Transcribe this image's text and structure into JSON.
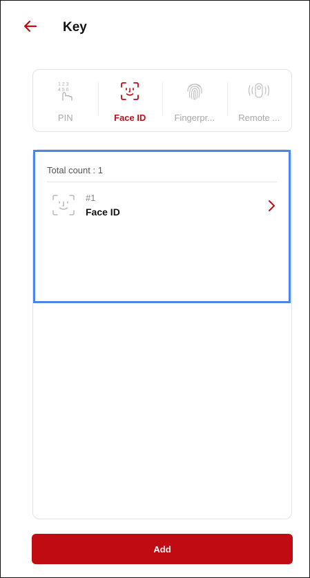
{
  "header": {
    "title": "Key",
    "back_icon": "arrow-left-icon",
    "accent_color": "#c10b12"
  },
  "tabs": [
    {
      "label": "PIN",
      "icon": "pin-keypad-icon",
      "active": false
    },
    {
      "label": "Face ID",
      "icon": "face-id-icon",
      "active": true
    },
    {
      "label": "Fingerpr...",
      "icon": "fingerprint-icon",
      "active": false
    },
    {
      "label": "Remote ...",
      "icon": "remote-icon",
      "active": false
    }
  ],
  "list": {
    "total_count_label": "Total count : 1",
    "items": [
      {
        "number": "#1",
        "name": "Face ID",
        "icon": "face-id-icon"
      }
    ]
  },
  "footer": {
    "add_label": "Add"
  }
}
